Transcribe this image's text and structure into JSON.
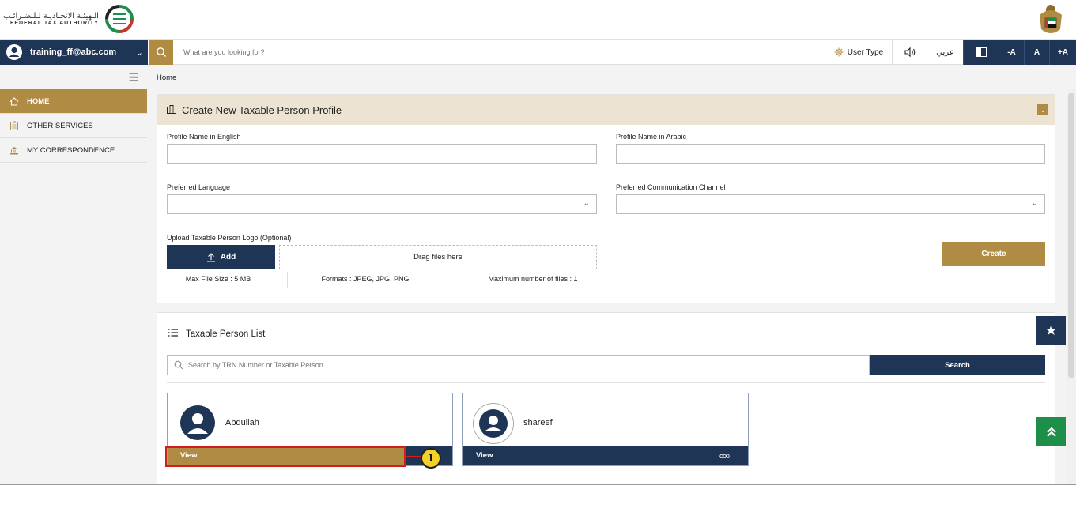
{
  "header": {
    "logo_arabic": "الـهيئـة الاتحـاديـة لـلـضـرائـب",
    "logo_english": "FEDERAL TAX AUTHORITY"
  },
  "topbar": {
    "user_email": "training_ff@abc.com",
    "search_placeholder": "What are you looking for?",
    "user_type_label": "User Type",
    "arabic_label": "عربي",
    "font_decrease": "-A",
    "font_normal": "A",
    "font_increase": "+A"
  },
  "sidebar": {
    "items": [
      {
        "label": "HOME",
        "icon": "home-icon",
        "active": true
      },
      {
        "label": "OTHER SERVICES",
        "icon": "clipboard-icon",
        "active": false
      },
      {
        "label": "MY CORRESPONDENCE",
        "icon": "bank-icon",
        "active": false
      }
    ]
  },
  "breadcrumb": "Home",
  "create_panel": {
    "title": "Create New Taxable Person Profile",
    "name_en_label": "Profile Name in English",
    "name_en_value": "",
    "name_ar_label": "Profile Name in Arabic",
    "name_ar_value": "",
    "language_label": "Preferred Language",
    "language_value": "",
    "channel_label": "Preferred Communication Channel",
    "channel_value": "",
    "upload_label": "Upload Taxable Person Logo (Optional)",
    "add_label": "Add",
    "dropzone_label": "Drag files here",
    "max_size": "Max File Size : 5 MB",
    "formats": "Formats : JPEG, JPG, PNG",
    "max_files": "Maximum number of files : 1",
    "create_label": "Create"
  },
  "list_panel": {
    "title": "Taxable Person List",
    "search_placeholder": "Search by TRN Number or Taxable Person",
    "search_button": "Search",
    "cards": [
      {
        "name": "Abdullah",
        "view_label": "View"
      },
      {
        "name": "shareef",
        "view_label": "View",
        "more_label": "ooo"
      }
    ]
  },
  "annotation": {
    "number": "1"
  },
  "colors": {
    "navy": "#1f3555",
    "gold": "#b08b43",
    "green": "#1e8f4a",
    "highlight": "#d11f1f"
  }
}
